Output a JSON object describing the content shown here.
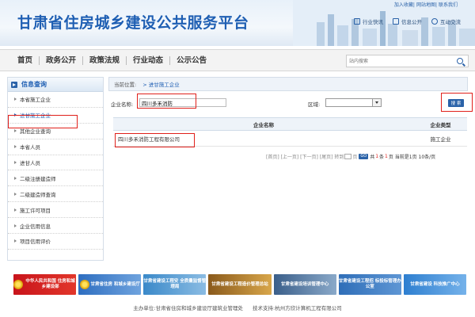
{
  "header": {
    "title": "甘肃省住房城乡建设公共服务平台",
    "top_links": [
      "加入收藏",
      "网站地图",
      "联系我们"
    ],
    "quick_links": [
      {
        "label": "行业快讯",
        "icon": "news-icon"
      },
      {
        "label": "信息公开",
        "icon": "info-icon"
      },
      {
        "label": "互动交流",
        "icon": "chat-icon"
      }
    ]
  },
  "nav": {
    "items": [
      "首页",
      "政务公开",
      "政策法规",
      "行业动态",
      "公示公告"
    ],
    "search_placeholder": "站内搜索"
  },
  "sidebar": {
    "title": "信息查询",
    "items": [
      {
        "label": "本省施工企业"
      },
      {
        "label": "进甘施工企业",
        "active": true
      },
      {
        "label": "其他企业查询"
      },
      {
        "label": "本省人员"
      },
      {
        "label": "进甘人员"
      },
      {
        "label": "二级注册建造师"
      },
      {
        "label": "二级建造师查询"
      },
      {
        "label": "施工许可项目"
      },
      {
        "label": "企业信用信息"
      },
      {
        "label": "项目信用评价"
      }
    ]
  },
  "breadcrumb": {
    "prefix": "当前位置:",
    "current": "> 进甘施工企业"
  },
  "form": {
    "company_label": "企业名称:",
    "company_value": "四川多禾消防",
    "area_label": "区域:",
    "area_value": "",
    "search_button": "搜 索"
  },
  "table": {
    "headers": [
      "企业名称",
      "企业类型"
    ],
    "rows": [
      {
        "name": "四川多禾消防工程有限公司",
        "type": "施工企业"
      }
    ]
  },
  "pager": {
    "links": "[首页] [上一页] [下一页] [尾页] 转到",
    "page_suffix": "页",
    "go": "GO",
    "total_prefix": "共",
    "total_count": "1",
    "total_mid": "条",
    "total_pages": "1",
    "total_suffix": "页 当前是1页 10条/页"
  },
  "banners": [
    {
      "label": "中华人民共和国 住房和城乡建设部",
      "color": "#c8141b"
    },
    {
      "label": "甘肃省住房 和城乡建设厅",
      "color": "#2e6ec0"
    },
    {
      "label": "甘肃省建设工程安 全质量监督管理局",
      "color": "#3a89c9"
    },
    {
      "label": "甘肃省建设工程造价管理总站",
      "color": "#b8842c"
    },
    {
      "label": "甘肃省建设培训管理中心",
      "color": "#4f7fb0"
    },
    {
      "label": "甘肃省建设工程招 标投标管理办公室",
      "color": "#2f6eb8"
    },
    {
      "label": "甘肃省建设 科技推广中心",
      "color": "#2e7fd0"
    }
  ],
  "footer": {
    "host": "主办单位:甘肃省住房和城乡建设厅建筑业管理处",
    "support": "技术支持:杭州方欣计算机工程有限公司"
  },
  "colors": {
    "brand_blue": "#1f5fb3",
    "highlight_red": "#e0201b"
  }
}
